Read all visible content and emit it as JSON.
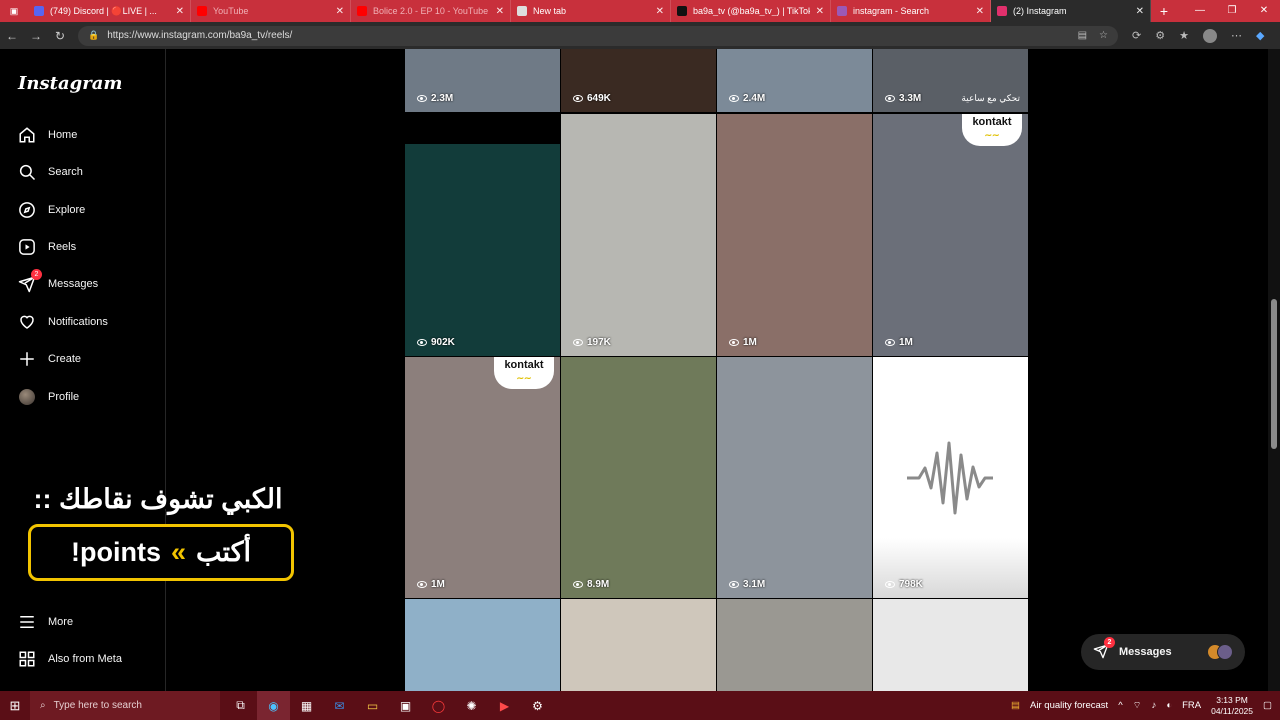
{
  "browser": {
    "tabs": [
      {
        "title": "(749) Discord | 🔴LIVE | ...",
        "favicon_color": "#5865f2",
        "active": false
      },
      {
        "title": "YouTube",
        "favicon_color": "#ff0000",
        "active": false
      },
      {
        "title": "Bolice 2.0 - EP 10 - YouTube",
        "favicon_color": "#ff0000",
        "active": false
      },
      {
        "title": "New tab",
        "favicon_color": "#dddddd",
        "active": false
      },
      {
        "title": "ba9a_tv (@ba9a_tv_) | TikTok",
        "favicon_color": "#111111",
        "active": false
      },
      {
        "title": "instagram - Search",
        "favicon_color": "#9b59b6",
        "active": false
      },
      {
        "title": "(2) Instagram",
        "favicon_color": "#e1306c",
        "active": true
      }
    ],
    "url": "https://www.instagram.com/ba9a_tv/reels/"
  },
  "sidebar": {
    "logo": "Instagram",
    "items": [
      {
        "label": "Home",
        "icon": "home-icon"
      },
      {
        "label": "Search",
        "icon": "search-icon"
      },
      {
        "label": "Explore",
        "icon": "compass-icon"
      },
      {
        "label": "Reels",
        "icon": "reels-icon"
      },
      {
        "label": "Messages",
        "icon": "messenger-icon",
        "badge": "2"
      },
      {
        "label": "Notifications",
        "icon": "heart-icon"
      },
      {
        "label": "Create",
        "icon": "plus-icon"
      },
      {
        "label": "Profile",
        "icon": "avatar"
      }
    ],
    "more": "More",
    "also_from_meta": "Also from Meta"
  },
  "overlay": {
    "title": "الكبي تشوف نقاطك ::",
    "command": "!points",
    "arabic": "أكتب"
  },
  "reels": {
    "rows": [
      [
        {
          "views": "2.3M",
          "bg": "#6f7a86"
        },
        {
          "views": "649K",
          "bg": "#3a2a22"
        },
        {
          "views": "2.4M",
          "bg": "#7c8a98"
        },
        {
          "views": "3.3M",
          "bg": "#5a5f66",
          "caption": "تحكي مع ساعية"
        }
      ],
      [
        {
          "views": "902K",
          "bg": "#123c3a"
        },
        {
          "views": "197K",
          "bg": "#b7b7b2"
        },
        {
          "views": "1M",
          "bg": "#8a6f68"
        },
        {
          "views": "1M",
          "bg": "#6b6f79",
          "sticker": "kontakt"
        }
      ],
      [
        {
          "views": "1M",
          "bg": "#8c7f7c",
          "sticker": "kontakt"
        },
        {
          "views": "8.9M",
          "bg": "#6f7a5a"
        },
        {
          "views": "3.1M",
          "bg": "#8d949c"
        },
        {
          "views": "798K",
          "bg": "#ffffff",
          "audio": true
        }
      ],
      [
        {
          "views": "",
          "bg": "#8fb0c8"
        },
        {
          "views": "",
          "bg": "#cfc7bb"
        },
        {
          "views": "",
          "bg": "#9a9892"
        },
        {
          "views": "",
          "bg": "#e8e8e8"
        }
      ]
    ]
  },
  "messages_pill": {
    "label": "Messages",
    "badge": "2"
  },
  "taskbar": {
    "search_placeholder": "Type here to search",
    "weather": "Air quality forecast",
    "lang": "FRA",
    "time": "3:13 PM",
    "date": "04/11/2025"
  }
}
